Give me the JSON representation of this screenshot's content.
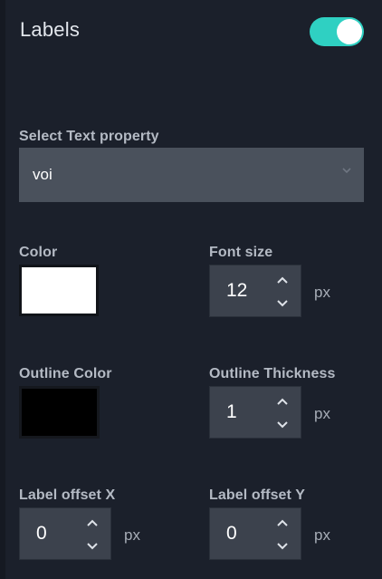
{
  "panel": {
    "title": "Labels",
    "enabled": true,
    "colors": {
      "toggle_on": "#2fd0c2",
      "background": "#1b202b",
      "input_bg": "#4a515c"
    }
  },
  "text_property": {
    "label": "Select Text property",
    "value": "voi",
    "icon": "chevron-down-icon"
  },
  "color": {
    "label": "Color",
    "value": "#ffffff"
  },
  "font_size": {
    "label": "Font size",
    "value": "12",
    "unit": "px"
  },
  "outline_color": {
    "label": "Outline Color",
    "value": "#000000"
  },
  "outline_thickness": {
    "label": "Outline Thickness",
    "value": "1",
    "unit": "px"
  },
  "offset_x": {
    "label": "Label offset X",
    "value": "0",
    "unit": "px"
  },
  "offset_y": {
    "label": "Label offset Y",
    "value": "0",
    "unit": "px"
  }
}
